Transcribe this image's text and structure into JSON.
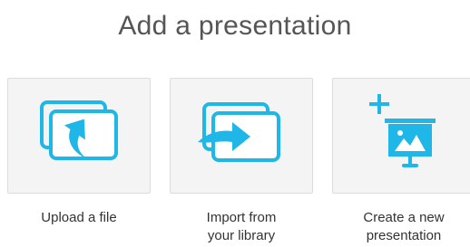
{
  "title": "Add a presentation",
  "accent_color": "#1fb6e8",
  "options": [
    {
      "label_line1": "Upload a file",
      "label_line2": "",
      "icon": "upload-file-icon"
    },
    {
      "label_line1": "Import from",
      "label_line2": "your library",
      "icon": "import-library-icon"
    },
    {
      "label_line1": "Create a new",
      "label_line2": "presentation",
      "icon": "create-presentation-icon"
    }
  ]
}
